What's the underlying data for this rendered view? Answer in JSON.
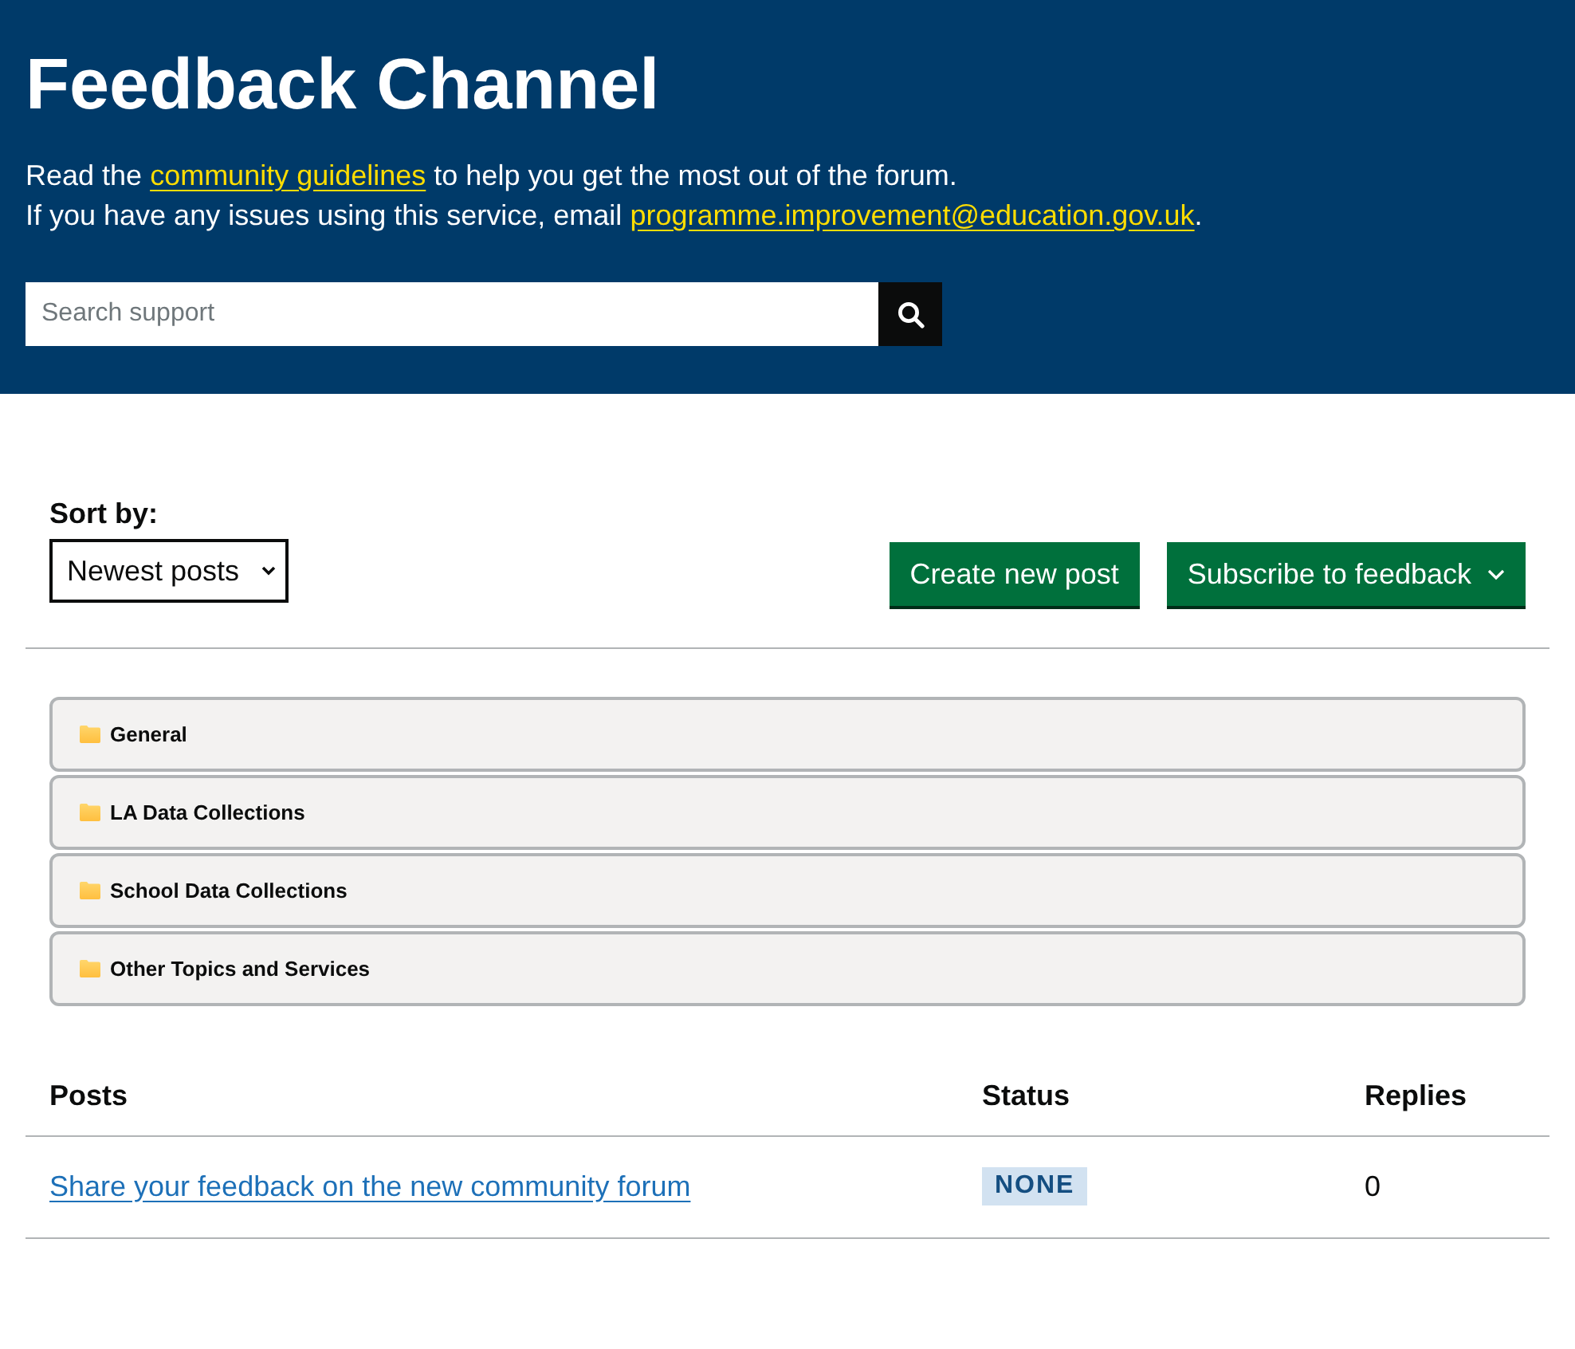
{
  "header": {
    "title": "Feedback Channel",
    "intro_lines": [
      {
        "before": "Read the ",
        "link": "community guidelines",
        "after": " to help you get the most out of the forum."
      },
      {
        "before": "If you have any issues using this service, email ",
        "link": "programme.improvement@education.gov.uk",
        "after": "."
      }
    ],
    "search": {
      "placeholder": "Search support"
    }
  },
  "sort": {
    "label": "Sort by:",
    "value": "Newest posts"
  },
  "buttons": [
    {
      "label": "Create new post",
      "kind": "plain"
    },
    {
      "label": "Subscribe to feedback",
      "kind": "dropdown"
    }
  ],
  "categories": [
    {
      "name": "General"
    },
    {
      "name": "LA Data Collections"
    },
    {
      "name": "School Data Collections"
    },
    {
      "name": "Other Topics and Services"
    }
  ],
  "posts_table": {
    "columns": [
      "Posts",
      "Status",
      "Replies"
    ],
    "rows": [
      {
        "title": "Share your feedback on the new community forum",
        "status": "NONE",
        "replies": "0"
      }
    ]
  }
}
